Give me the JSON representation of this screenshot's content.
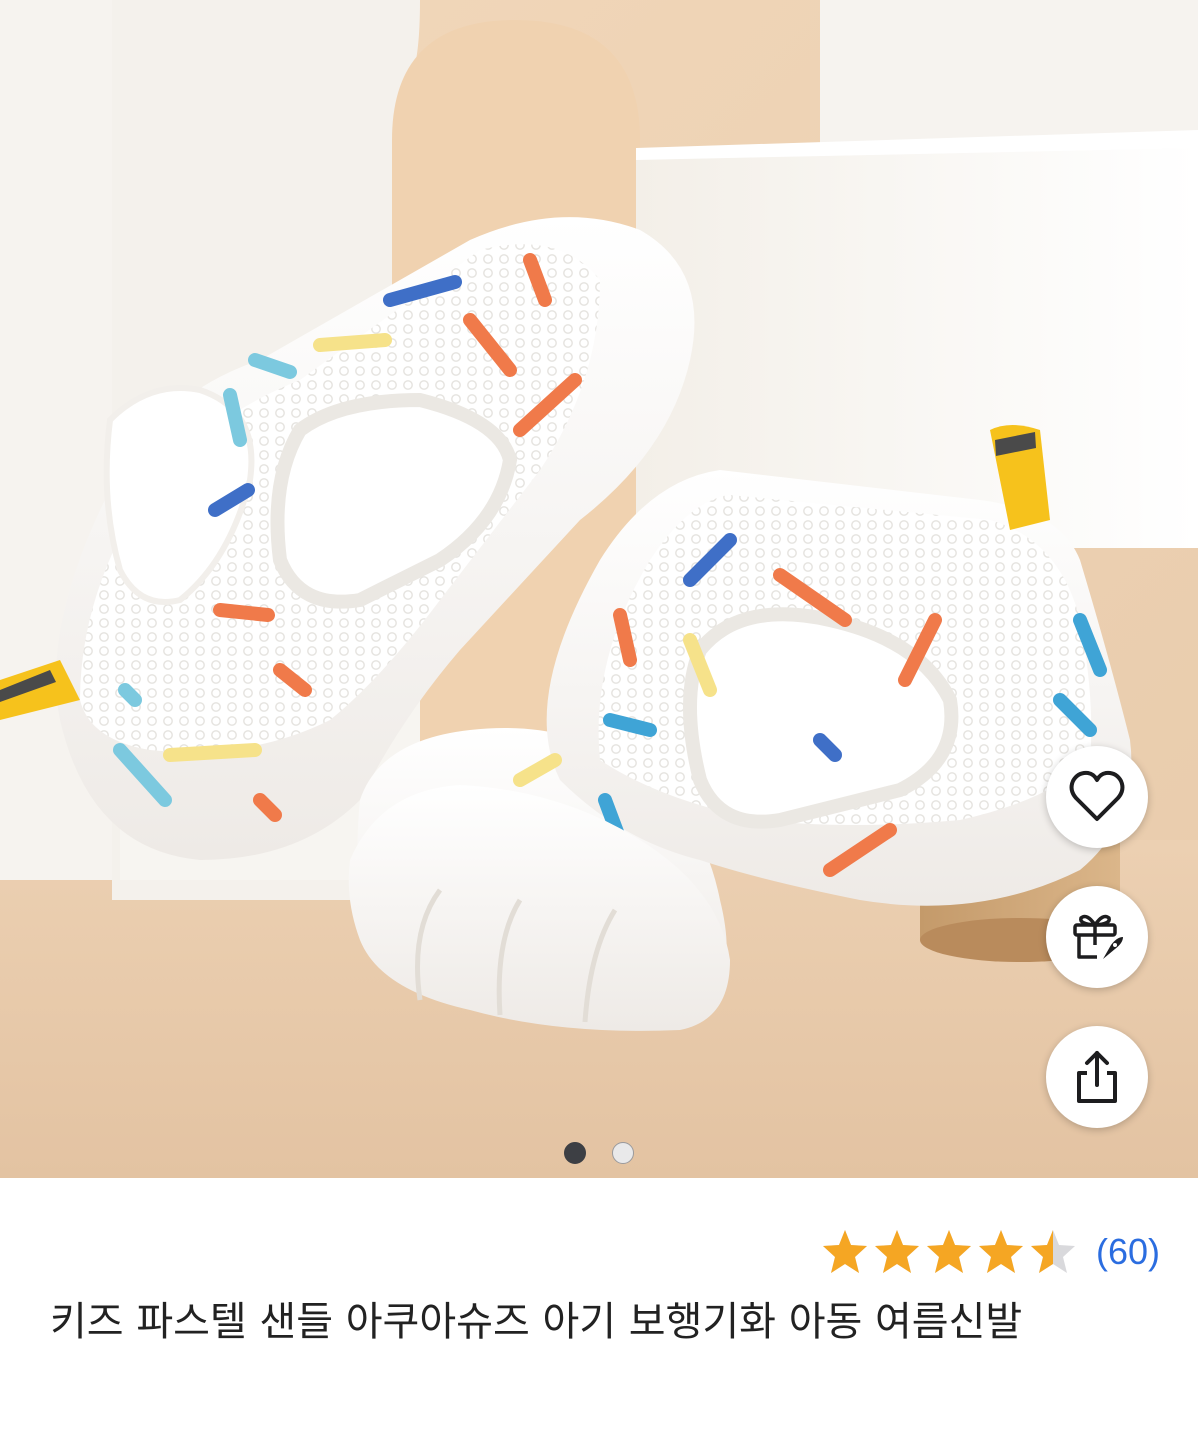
{
  "product": {
    "title": "키즈 파스텔 샌들 아쿠아슈즈 아기 보행기화 아동 여름신발",
    "image_alt": "Kids pastel mesh sandals",
    "rating": {
      "value": 4.5,
      "max": 5,
      "count_text": "(60)",
      "star_color": "#f5a623",
      "count_color": "#2b6de0"
    }
  },
  "gallery": {
    "total_images": 2,
    "active_index": 0
  },
  "actions": [
    {
      "name": "wishlist-button",
      "icon": "heart-icon"
    },
    {
      "name": "gift-button",
      "icon": "gift-rocket-icon"
    },
    {
      "name": "share-button",
      "icon": "share-icon"
    }
  ],
  "colors": {
    "background_beige": "#efd5b8",
    "text": "#222222"
  }
}
